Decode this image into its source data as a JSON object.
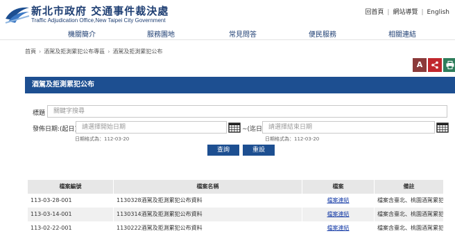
{
  "header": {
    "title": "新北市政府 交通事件裁決處",
    "subtitle": "Traffic Adjudication Office,New Taipei City Government",
    "links": [
      "回首頁",
      "網站導覽",
      "English"
    ]
  },
  "nav": {
    "items": [
      "機關簡介",
      "服務園地",
      "常見問答",
      "便民服務",
      "相關連結"
    ]
  },
  "breadcrumb": [
    "首頁",
    "酒駕及拒測累犯公布專區",
    "酒駕及拒測累犯公布"
  ],
  "tools": {
    "font_label": "A",
    "colors": {
      "font": "#8b3a3a",
      "share": "#c1272d",
      "print": "#2e7d5b"
    }
  },
  "page": {
    "title": "酒駕及拒測累犯公布"
  },
  "search": {
    "title_label": "標題",
    "title_placeholder": "關鍵字搜尋",
    "date_label": "發佈日期:(起日)",
    "start_placeholder": "請選擇開始日期",
    "to_label": "~(迄日)",
    "end_placeholder": "請選擇結束日期",
    "start_hint": "日期格式為：112-03-20",
    "end_hint": "日期格式為：112-03-20",
    "query_button": "查詢",
    "reset_button": "重設"
  },
  "table": {
    "headers": [
      "檔案編號",
      "檔案名稱",
      "檔案",
      "備註"
    ],
    "rows": [
      [
        "113-03-28-001",
        "1130328酒駕及拒測累犯公布資料",
        "檔案連結",
        "檔案含臺北、桃園酒駕累犯公布連結"
      ],
      [
        "113-03-14-001",
        "1130314酒駕及拒測累犯公布資料",
        "檔案連結",
        "檔案含臺北、桃園酒駕累犯公布連結"
      ],
      [
        "113-02-22-001",
        "1130222酒駕及拒測累犯公布資料",
        "檔案連結",
        "檔案含臺北、桃園酒駕累犯公布連結"
      ]
    ]
  }
}
